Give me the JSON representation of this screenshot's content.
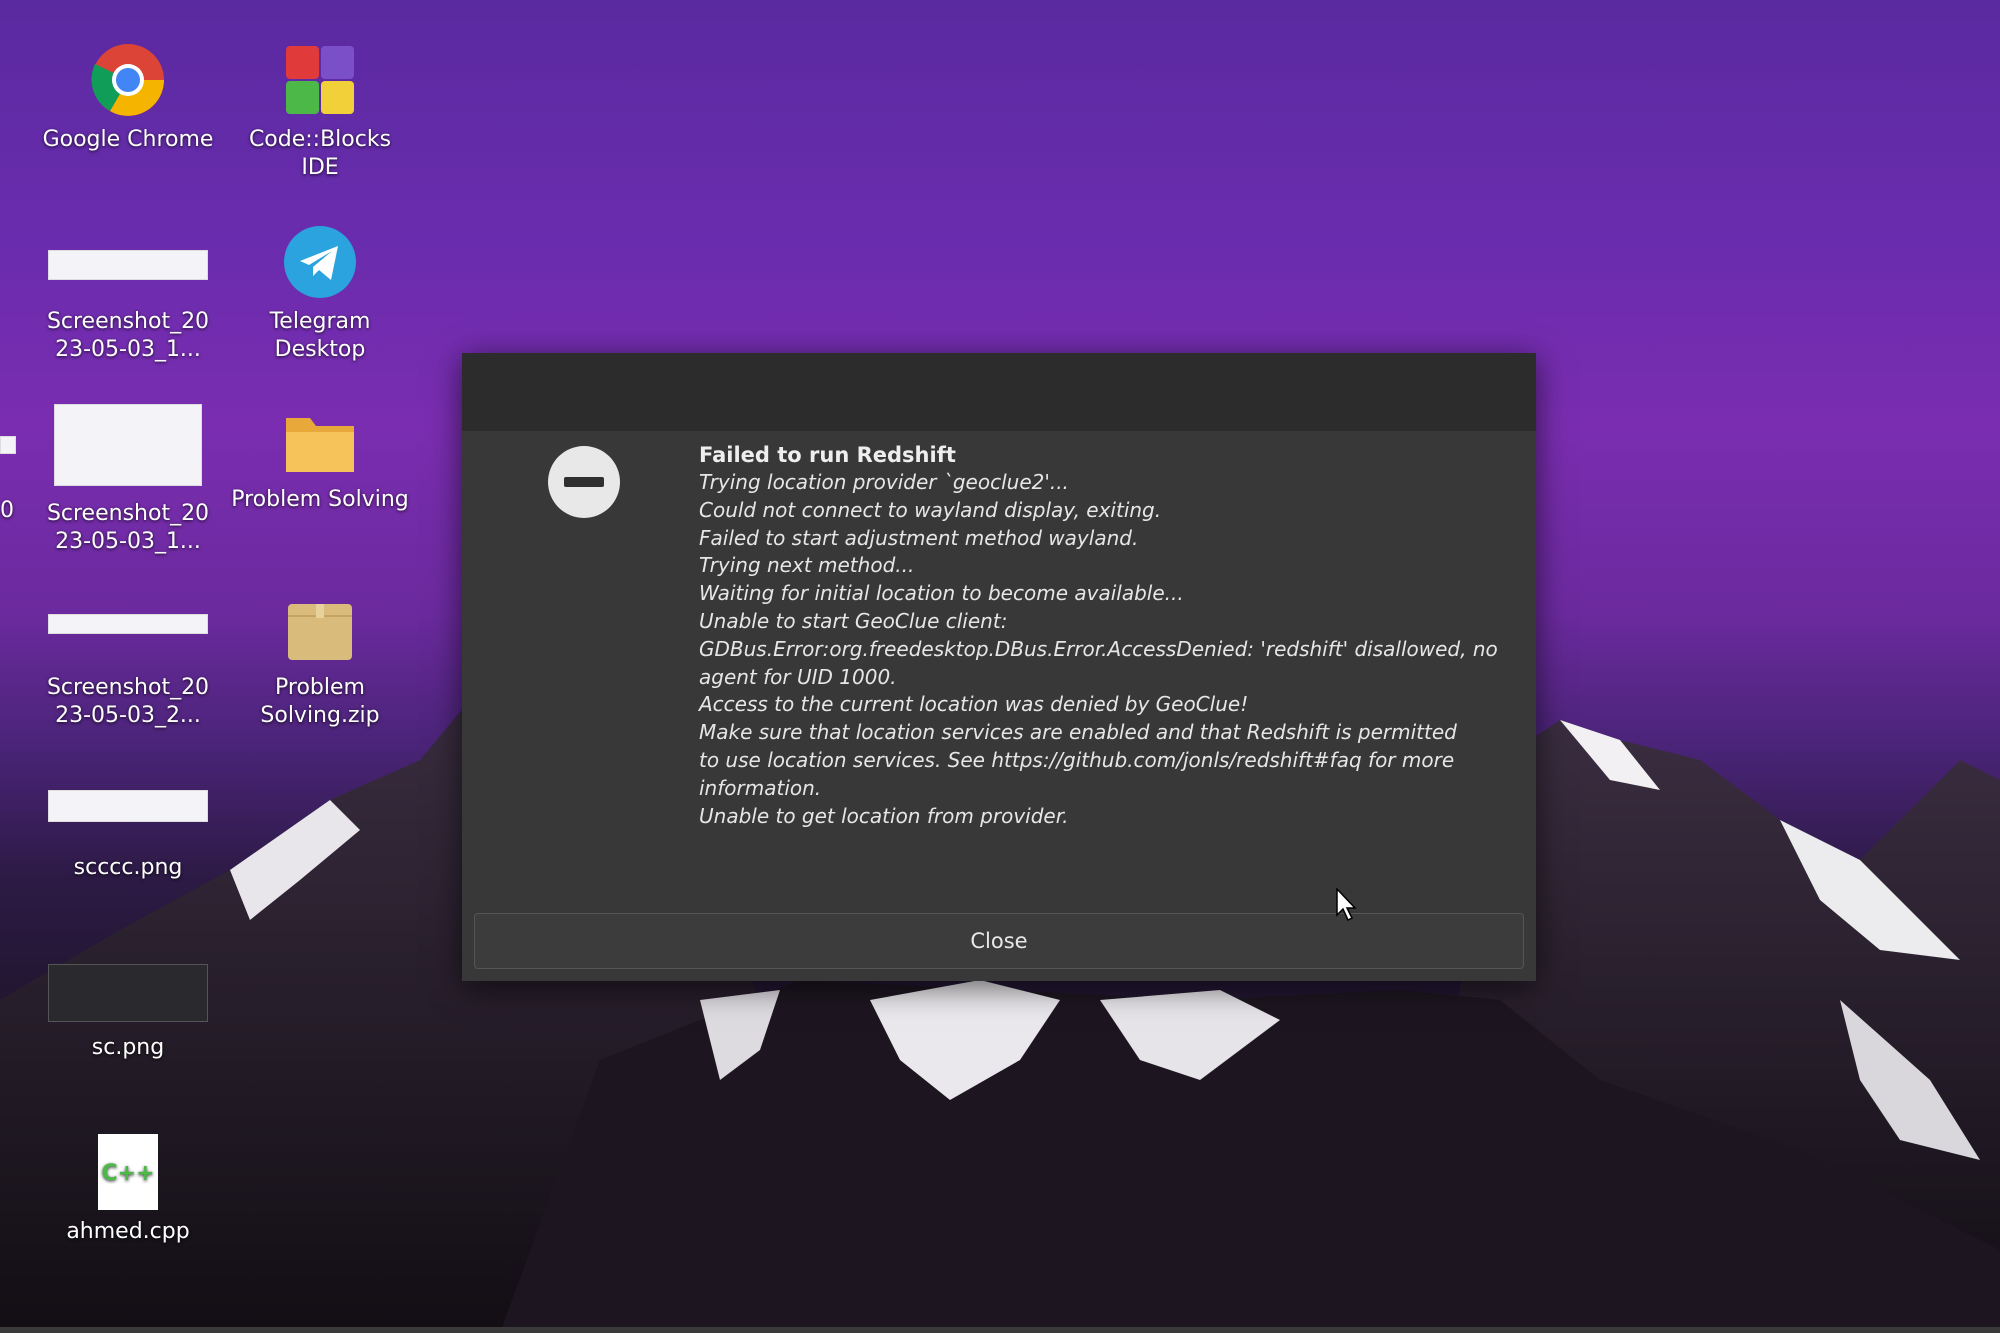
{
  "desktop": {
    "icons": [
      {
        "label": "Google Chrome",
        "icon": "chrome-icon"
      },
      {
        "label": "Code::Blocks IDE",
        "icon": "codeblocks-icon"
      },
      {
        "label": "Screenshot_20 23-05-03_1...",
        "icon": "image-thumbnail-icon"
      },
      {
        "label": "Telegram Desktop",
        "icon": "telegram-icon"
      },
      {
        "label": "Screenshot_20 23-05-03_1...",
        "icon": "image-thumbnail-icon"
      },
      {
        "label": "Problem Solving",
        "icon": "folder-icon"
      },
      {
        "label": "Screenshot_20 23-05-03_2...",
        "icon": "image-thumbnail-icon"
      },
      {
        "label": "Problem Solving.zip",
        "icon": "archive-icon"
      },
      {
        "label": "scccc.png",
        "icon": "image-thumbnail-icon"
      },
      {
        "label": "sc.png",
        "icon": "image-thumbnail-icon"
      },
      {
        "label": "ahmed.cpp",
        "icon": "cpp-file-icon"
      }
    ],
    "partial_left_text": "0"
  },
  "dialog": {
    "title": "Failed to run Redshift",
    "lines": [
      "Trying location provider `geoclue2'...",
      "Could not connect to wayland display, exiting.",
      "Failed to start adjustment method wayland.",
      "Trying next method...",
      "Waiting for initial location to become available...",
      "Unable to start GeoClue client:",
      "GDBus.Error:org.freedesktop.DBus.Error.AccessDenied: 'redshift' disallowed, no",
      "agent for UID 1000.",
      "Access to the current location was denied by GeoClue!",
      "Make sure that location services are enabled and that Redshift is permitted",
      "to use location services. See https://github.com/jonls/redshift#faq for more",
      "information.",
      "Unable to get location from provider."
    ],
    "close_label": "Close"
  }
}
